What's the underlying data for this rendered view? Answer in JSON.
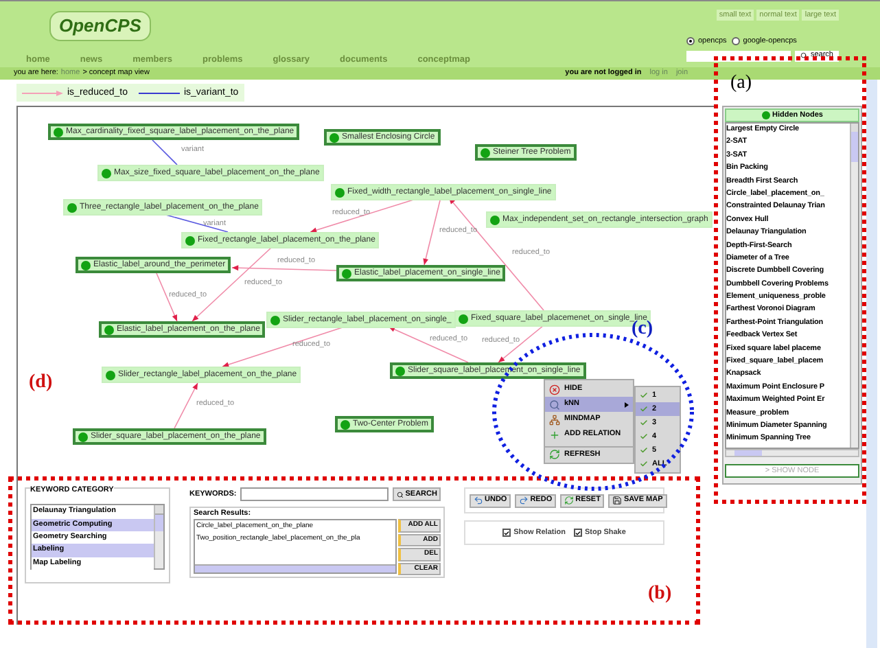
{
  "header": {
    "logo": "OpenCPS",
    "text_size_links": [
      "small text",
      "normal text",
      "large text"
    ],
    "search_scopes": [
      {
        "label": "opencps",
        "selected": true
      },
      {
        "label": "google-opencps",
        "selected": false
      }
    ],
    "search_button": "search",
    "nav": [
      "home",
      "news",
      "members",
      "problems",
      "glossary",
      "documents",
      "conceptmap"
    ]
  },
  "breadcrumb": {
    "prefix": "you are here:",
    "home": "home",
    "current": "> concept map view"
  },
  "login": {
    "status": "you are not logged in",
    "links": [
      "log in",
      "join"
    ]
  },
  "legend": [
    {
      "kind": "reduced",
      "label": "is_reduced_to"
    },
    {
      "kind": "variant",
      "label": "is_variant_to"
    }
  ],
  "nodes": [
    {
      "label": "Max_cardinality_fixed_square_label_placement_on_the_plane",
      "highlighted": true
    },
    {
      "label": "Smallest Enclosing Circle",
      "highlighted": true
    },
    {
      "label": "Max_size_fixed_square_label_placement_on_the_plane",
      "highlighted": false
    },
    {
      "label": "Steiner Tree Problem",
      "highlighted": true
    },
    {
      "label": "Fixed_width_rectangle_label_placement_on_single_line",
      "highlighted": false
    },
    {
      "label": "Three_rectangle_label_placement_on_the_plane",
      "highlighted": false
    },
    {
      "label": "Max_independent_set_on_rectangle_intersection_graph",
      "highlighted": false
    },
    {
      "label": "Fixed_rectangle_label_placement_on_the_plane",
      "highlighted": false
    },
    {
      "label": "Elastic_label_around_the_perimeter",
      "highlighted": true
    },
    {
      "label": "Elastic_label_placement_on_single_line",
      "highlighted": true
    },
    {
      "label": "Elastic_label_placement_on_the_plane",
      "highlighted": true
    },
    {
      "label": "Slider_rectangle_label_placement_on_single_",
      "highlighted": false
    },
    {
      "label": "Fixed_square_label_placemenet_on_single_line",
      "highlighted": false
    },
    {
      "label": "Slider_square_label_placement_on_single_line",
      "highlighted": true
    },
    {
      "label": "Slider_rectangle_label_placement_on_the_plane",
      "highlighted": false
    },
    {
      "label": "Two-Center Problem",
      "highlighted": true
    },
    {
      "label": "Slider_square_label_placement_on_the_plane",
      "highlighted": true
    }
  ],
  "edges": [
    {
      "kind": "variant",
      "label": "variant"
    },
    {
      "kind": "variant",
      "label": "variant"
    },
    {
      "kind": "reduced",
      "label": "reduced_to"
    },
    {
      "kind": "reduced",
      "label": "reduced_to"
    },
    {
      "kind": "reduced",
      "label": "reduced_to"
    },
    {
      "kind": "reduced",
      "label": "reduced_to"
    },
    {
      "kind": "reduced",
      "label": "reduced_to"
    },
    {
      "kind": "reduced",
      "label": "reduced_to"
    },
    {
      "kind": "reduced",
      "label": "reduced_to"
    },
    {
      "kind": "reduced",
      "label": "reduced_to"
    },
    {
      "kind": "reduced",
      "label": "reduced_to"
    },
    {
      "kind": "reduced",
      "label": "reduced_to"
    }
  ],
  "context_menu": {
    "items": [
      {
        "kind": "hide",
        "label": "HIDE",
        "selected": false
      },
      {
        "kind": "knn",
        "label": "kNN",
        "selected": true
      },
      {
        "kind": "mindmap",
        "label": "MINDMAP",
        "selected": false
      },
      {
        "kind": "add_relation",
        "label": "ADD RELATION",
        "selected": false
      },
      {
        "kind": "refresh",
        "label": "REFRESH",
        "selected": false
      }
    ],
    "submenu": [
      {
        "label": "1",
        "checked": true,
        "selected": false
      },
      {
        "label": "2",
        "checked": true,
        "selected": true
      },
      {
        "label": "3",
        "checked": true,
        "selected": false
      },
      {
        "label": "4",
        "checked": true,
        "selected": false
      },
      {
        "label": "5",
        "checked": true,
        "selected": false
      },
      {
        "label": "ALL",
        "checked": true,
        "selected": false
      }
    ]
  },
  "hidden_nodes": {
    "title": "Hidden Nodes",
    "items": [
      "Largest Empty Circle",
      "2-SAT",
      "3-SAT",
      "Bin Packing",
      "Breadth First Search",
      "Circle_label_placement_on_",
      "Constrainted Delaunay Trian",
      "Convex Hull",
      "Delaunay Triangulation",
      "Depth-First-Search",
      "Diameter of a Tree",
      "Discrete Dumbbell Covering",
      "Dumbbell Covering Problems",
      "Element_uniqueness_proble",
      "Farthest Voronoi Diagram",
      "Farthest-Point Triangulation",
      "Feedback Vertex Set",
      "Fixed square label placeme",
      "Fixed_square_label_placem",
      "Knapsack",
      "Maximum Point Enclosure P",
      "Maximum Weighted Point Er",
      "Measure_problem",
      "Minimum Diameter Spanning",
      "Minimum Spanning Tree"
    ],
    "button": "> SHOW NODE"
  },
  "keyword_category": {
    "title": "KEYWORD CATEGORY",
    "items": [
      {
        "label": "Delaunay Triangulation",
        "selected": false
      },
      {
        "label": "Geometric Computing",
        "selected": true
      },
      {
        "label": "Geometry Searching",
        "selected": false
      },
      {
        "label": "Labeling",
        "selected": true
      },
      {
        "label": "Map Labeling",
        "selected": false
      }
    ]
  },
  "keywords": {
    "label": "KEYWORDS:",
    "button": "SEARCH"
  },
  "search_results": {
    "title": "Search Results:",
    "items": [
      "Circle_label_placement_on_the_plane",
      "Two_position_rectangle_label_placement_on_the_pla"
    ],
    "buttons": [
      "ADD ALL",
      "ADD",
      "DEL",
      "CLEAR"
    ]
  },
  "toolbar": [
    {
      "kind": "undo",
      "label": "UNDO"
    },
    {
      "kind": "redo",
      "label": "REDO"
    },
    {
      "kind": "reset",
      "label": "RESET"
    },
    {
      "kind": "save",
      "label": "SAVE MAP"
    }
  ],
  "options": [
    {
      "label": "Show Relation",
      "checked": true
    },
    {
      "label": "Stop Shake",
      "checked": true
    }
  ],
  "annotations": [
    "(a)",
    "(b)",
    "(c)",
    "(d)"
  ]
}
